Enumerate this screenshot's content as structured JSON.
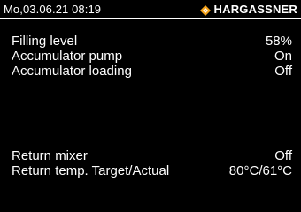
{
  "status_bar": {
    "datetime": "Mo,03.06.21 08:19",
    "brand_name": "HARGASSNER",
    "brand_icon": "hargassner-diamond-icon",
    "brand_color": "#f5a31a"
  },
  "readings": [
    {
      "label": "Filling level",
      "value": "58%"
    },
    {
      "label": "Accumulator pump",
      "value": "On"
    },
    {
      "label": "Accumulator loading",
      "value": "Off"
    },
    {
      "label": "Return mixer",
      "value": "Off"
    },
    {
      "label": "Return temp. Target/Actual",
      "value": "80°C/61°C"
    }
  ],
  "colors": {
    "background": "#000000",
    "text": "#ffffff"
  }
}
